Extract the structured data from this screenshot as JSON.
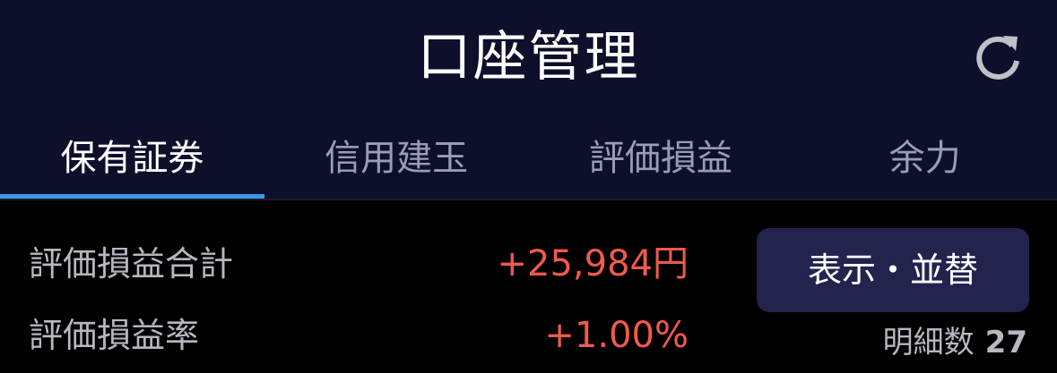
{
  "header": {
    "title": "口座管理",
    "refresh_icon": "refresh-icon"
  },
  "tabs": [
    {
      "label": "保有証券",
      "active": true
    },
    {
      "label": "信用建玉",
      "active": false
    },
    {
      "label": "評価損益",
      "active": false
    },
    {
      "label": "余力",
      "active": false
    }
  ],
  "summary": {
    "total_label": "評価損益合計",
    "total_value": "+25,984円",
    "rate_label": "評価損益率",
    "rate_value": "+1.00%",
    "sort_button_label": "表示・並替",
    "detail_count_label": "明細数",
    "detail_count_value": "27"
  },
  "colors": {
    "header_bg": "#0e0f2b",
    "body_bg": "#000000",
    "accent": "#3b98e6",
    "positive": "#f05a4e",
    "button_bg": "#22244e"
  }
}
